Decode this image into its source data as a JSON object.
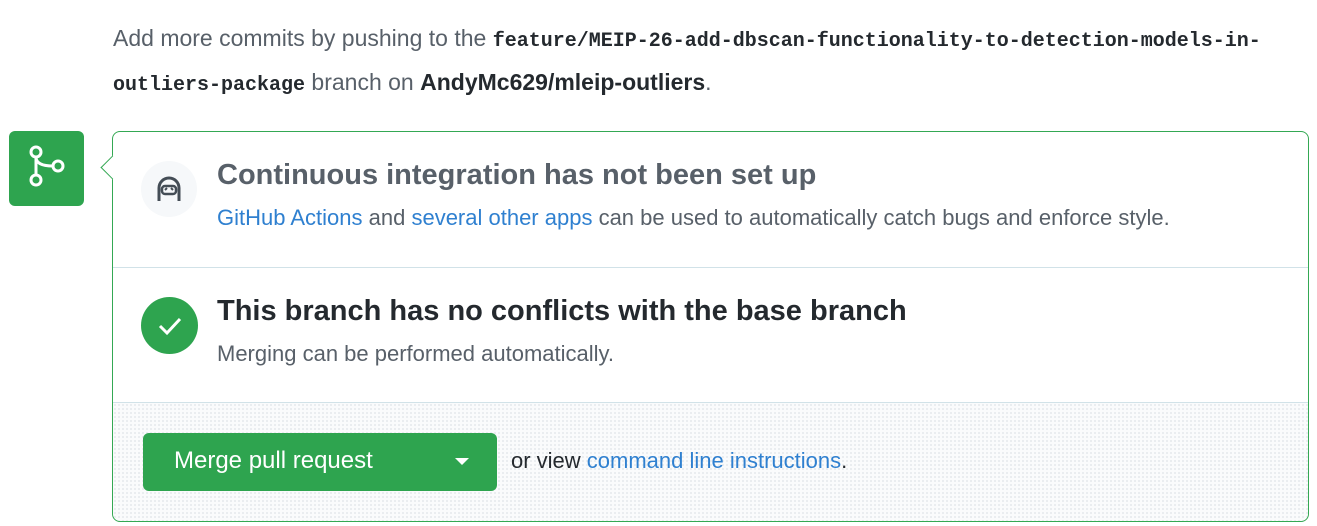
{
  "intro": {
    "prefix": "Add more commits by pushing to the ",
    "branch": "feature/MEIP-26-add-dbscan-functionality-to-detection-models-in-outliers-package",
    "middle": " branch on ",
    "repo": "AndyMc629/mleip-outliers",
    "suffix": "."
  },
  "ci": {
    "title": "Continuous integration has not been set up",
    "link_actions": "GitHub Actions",
    "and": " and ",
    "link_apps": "several other apps",
    "desc_rest": " can be used to automatically catch bugs and enforce style."
  },
  "conflicts": {
    "title": "This branch has no conflicts with the base branch",
    "desc": "Merging can be performed automatically."
  },
  "merge": {
    "button_label": "Merge pull request",
    "or_view": "or view ",
    "cli_link": "command line instructions",
    "period": "."
  },
  "icons": {
    "merge": "git-merge-icon",
    "ci": "robot-icon",
    "check": "check-icon",
    "caret": "caret-down-icon"
  },
  "colors": {
    "success": "#2ea44f",
    "link": "#2f80d0",
    "muted": "#586069",
    "text": "#24292e"
  }
}
